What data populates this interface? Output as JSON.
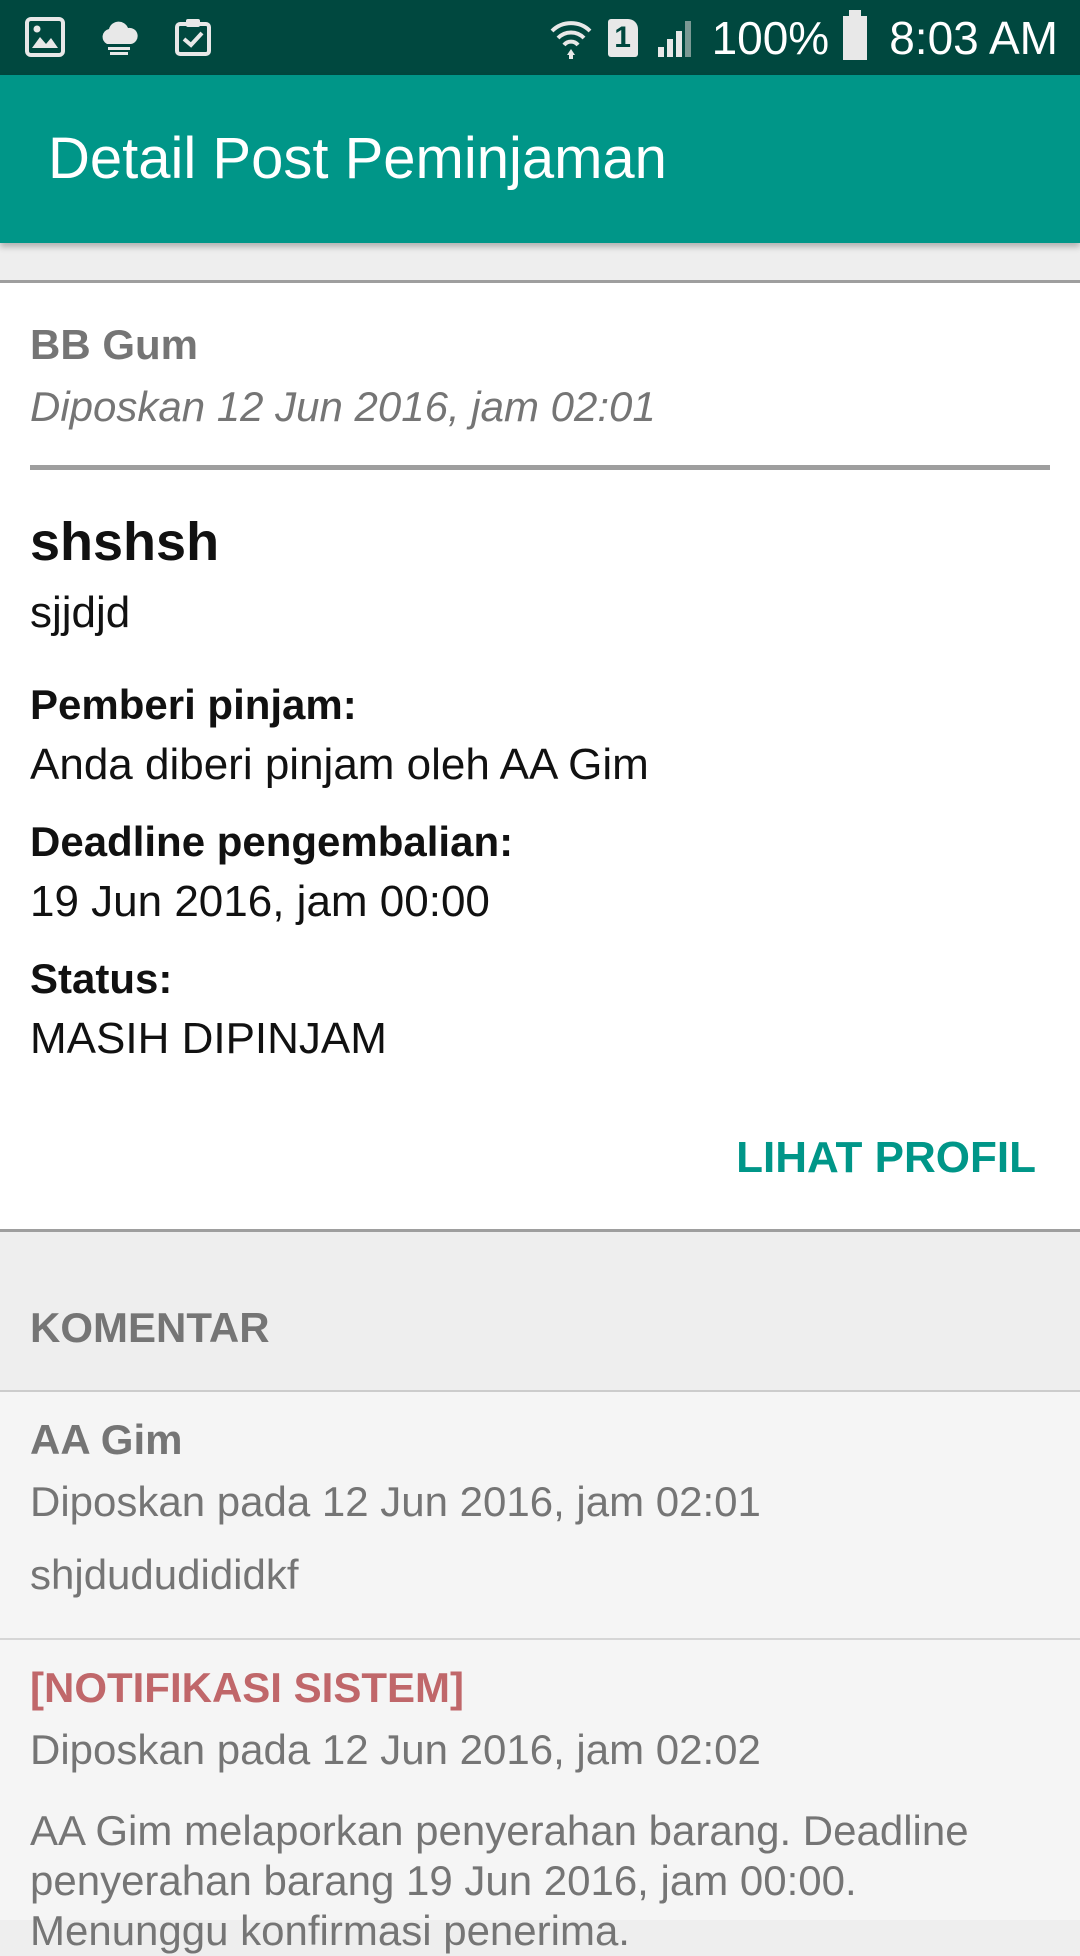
{
  "status_bar": {
    "battery": "100%",
    "time": "8:03 AM",
    "left_icons": [
      "gallery-icon",
      "cloud-icon",
      "clipboard-check-icon"
    ],
    "right_icons": [
      "wifi-icon",
      "sim-icon",
      "signal-icon",
      "battery-icon"
    ],
    "sim_label": "1"
  },
  "app_bar": {
    "title": "Detail Post Peminjaman",
    "color": "#009688"
  },
  "post": {
    "author": "BB Gum",
    "posted": "Diposkan 12 Jun 2016, jam 02:01",
    "title": "shshsh",
    "description": "sjjdjd",
    "lender_label": "Pemberi pinjam:",
    "lender_value": "Anda diberi pinjam oleh AA Gim",
    "deadline_label": "Deadline pengembalian:",
    "deadline_value": "19 Jun 2016, jam 00:00",
    "status_label": "Status:",
    "status_value": "MASIH DIPINJAM",
    "profile_button": "LIHAT PROFIL"
  },
  "comments": {
    "header": "KOMENTAR",
    "items": [
      {
        "author": "AA Gim",
        "date": "Diposkan pada 12 Jun 2016, jam 02:01",
        "body": "shjdududididkf"
      },
      {
        "author": "[NOTIFIKASI SISTEM]",
        "date": "Diposkan pada 12 Jun 2016, jam 02:02",
        "body": "AA Gim melaporkan penyerahan barang. Deadline penyerahan barang 19 Jun 2016, jam 00:00. Menunggu konfirmasi penerima."
      }
    ]
  },
  "colors": {
    "status_bar": "#00483f",
    "accent": "#009688",
    "system_notification": "#c0676a"
  }
}
